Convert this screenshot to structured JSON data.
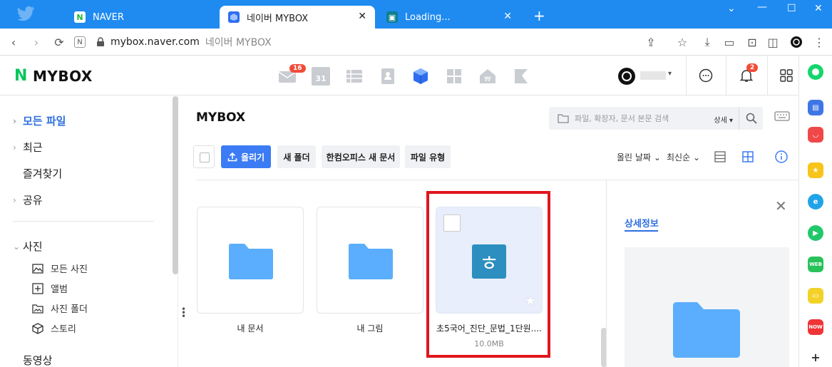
{
  "browser": {
    "tabs": [
      {
        "label": "NAVER",
        "favicon": "naver-icon"
      },
      {
        "label": "네이버 MYBOX",
        "favicon": "mybox-icon",
        "active": true
      },
      {
        "label": "Loading...",
        "favicon": "loading-icon"
      }
    ],
    "address": {
      "url": "mybox.naver.com",
      "page_title": "네이버 MYBOX"
    },
    "accent": "#1f8bf0"
  },
  "header": {
    "logo_mark": "N",
    "logo_text": "MYBOX",
    "mail_badge": "16",
    "calendar_label": "31",
    "notif_badge": "2"
  },
  "sidebar": {
    "items": [
      {
        "label": "모든 파일",
        "chevron": "›",
        "active": true
      },
      {
        "label": "최근",
        "chevron": "›"
      },
      {
        "label": "즐겨찾기"
      },
      {
        "label": "공유",
        "chevron": "›"
      },
      {
        "label": "사진",
        "chevron": "⌄"
      }
    ],
    "photo_sub": [
      "모든 사진",
      "앨범",
      "사진 폴더",
      "스토리"
    ],
    "video_label": "동영상"
  },
  "main": {
    "title": "MYBOX",
    "search_placeholder": "파일, 확장자, 문서 본문 검색",
    "search_option": "상세",
    "buttons": {
      "upload": "올리기",
      "new_folder": "새 폴더",
      "hancom": "한컴오피스 새 문서",
      "file_type": "파일 유형"
    },
    "sort_field": "올린 날짜",
    "sort_order": "최신순",
    "files": [
      {
        "name": "내 문서",
        "type": "folder"
      },
      {
        "name": "내 그림",
        "type": "folder"
      },
      {
        "name": "초5국어_진단_문법_1단원....",
        "type": "hwp",
        "size": "10.0MB",
        "hwp_glyph": "ㅎ"
      }
    ]
  },
  "detail": {
    "tab": "상세정보"
  },
  "colors": {
    "primary_blue": "#3b7cf4",
    "naver_green": "#03c75a",
    "folder_blue": "#5aaefd",
    "highlight_red": "#e0161e"
  }
}
